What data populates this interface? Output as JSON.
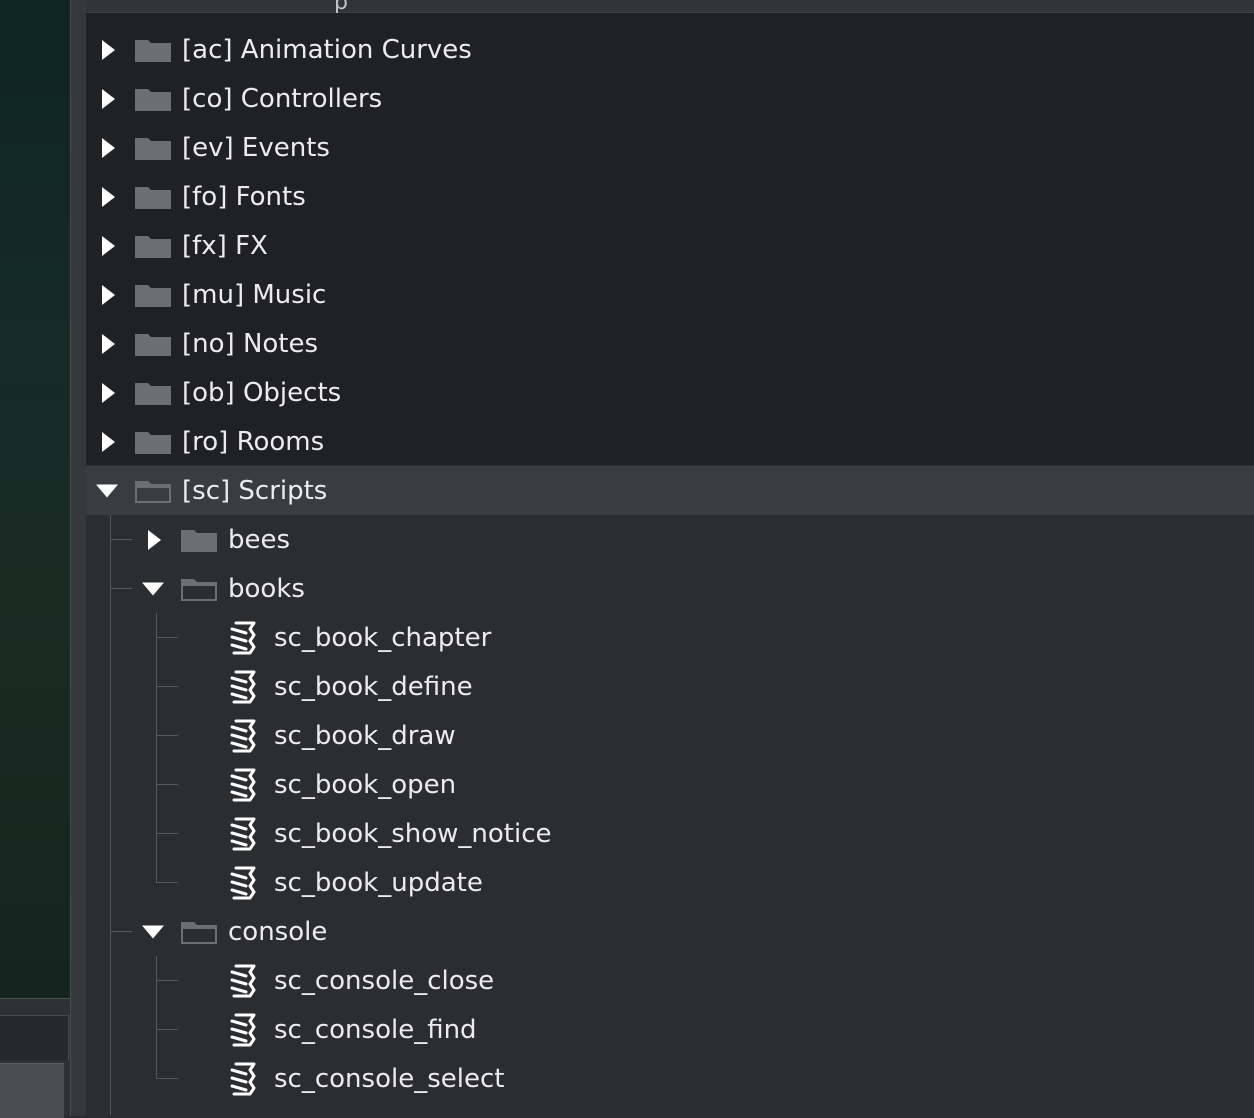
{
  "panel": {
    "header_text": "p"
  },
  "tree": {
    "top_folders": [
      {
        "label": "[ac] Animation Curves",
        "icon": "folder-icon"
      },
      {
        "label": "[co] Controllers",
        "icon": "folder-icon"
      },
      {
        "label": "[ev] Events",
        "icon": "folder-icon"
      },
      {
        "label": "[fo] Fonts",
        "icon": "folder-icon"
      },
      {
        "label": "[fx] FX",
        "icon": "folder-icon"
      },
      {
        "label": "[mu] Music",
        "icon": "folder-icon"
      },
      {
        "label": "[no] Notes",
        "icon": "folder-icon"
      },
      {
        "label": "[ob] Objects",
        "icon": "folder-icon"
      },
      {
        "label": "[ro] Rooms",
        "icon": "folder-icon"
      }
    ],
    "scripts_folder": {
      "label": "[sc] Scripts",
      "icon": "folder-open-icon",
      "expanded": true
    },
    "subfolders": [
      {
        "label": "bees",
        "expanded": false,
        "items": []
      },
      {
        "label": "books",
        "expanded": true,
        "items": [
          {
            "label": "sc_book_chapter",
            "icon": "script-icon"
          },
          {
            "label": "sc_book_define",
            "icon": "script-icon"
          },
          {
            "label": "sc_book_draw",
            "icon": "script-icon"
          },
          {
            "label": "sc_book_open",
            "icon": "script-icon"
          },
          {
            "label": "sc_book_show_notice",
            "icon": "script-icon"
          },
          {
            "label": "sc_book_update",
            "icon": "script-icon"
          }
        ]
      },
      {
        "label": "console",
        "expanded": true,
        "items": [
          {
            "label": "sc_console_close",
            "icon": "script-icon"
          },
          {
            "label": "sc_console_find",
            "icon": "script-icon"
          },
          {
            "label": "sc_console_select",
            "icon": "script-icon"
          }
        ]
      }
    ]
  },
  "colors": {
    "panel_bg": "#2b2d30",
    "top_area_bg": "#202124",
    "selected_row": "#393c41",
    "text": "#ececec",
    "folder": "#6b6e72"
  }
}
